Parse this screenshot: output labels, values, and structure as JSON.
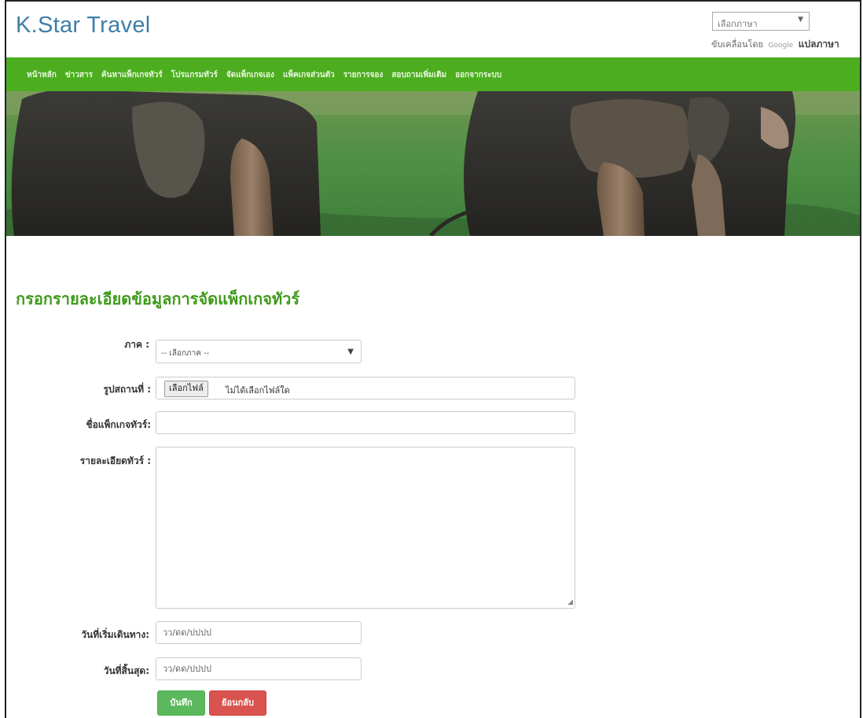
{
  "brand": "K.Star Travel",
  "language_widget": {
    "select_value": "เลือกภาษา",
    "powered_by": "ขับเคลื่อนโดย",
    "google": "Google",
    "translate": "แปลภาษา"
  },
  "nav": {
    "items": [
      "หน้าหลัก",
      "ข่าวสาร",
      "ค้นหาแพ็กเกจทัวร์",
      "โปรแกรมทัวร์",
      "จัดแพ็กเกจเอง",
      "แพ็คเกจส่วนตัว",
      "รายการจอง",
      "สอบถามเพิ่มเติม",
      "ออกจากระบบ"
    ]
  },
  "form": {
    "title": "กรอกรายละเอียดข้อมูลการจัดแพ็กเกจทัวร์",
    "region_label": "ภาค :",
    "region_value": "-- เลือกภาค --",
    "photo_label": "รูปสถานที่ :",
    "file_button": "เลือกไฟล์",
    "file_status": "ไม่ได้เลือกไฟล์ใด",
    "package_name_label": "ชื่อแพ็กเกจทัวร์:",
    "package_name_value": "",
    "details_label": "รายละเอียดทัวร์ :",
    "start_date_label": "วันที่เริ่มเดินทาง:",
    "start_date_placeholder": "วว/ดด/ปปปป",
    "end_date_label": "วันที่สิ้นสุด:",
    "end_date_placeholder": "วว/ดด/ปปปป",
    "save_label": "บันทึก",
    "back_label": "ย้อนกลับ"
  },
  "colors": {
    "nav_green": "#4cae1f",
    "title_green": "#3e9a1a",
    "brand_blue": "#3f7ea8",
    "save_green": "#5cb85c",
    "back_red": "#d9534f"
  }
}
